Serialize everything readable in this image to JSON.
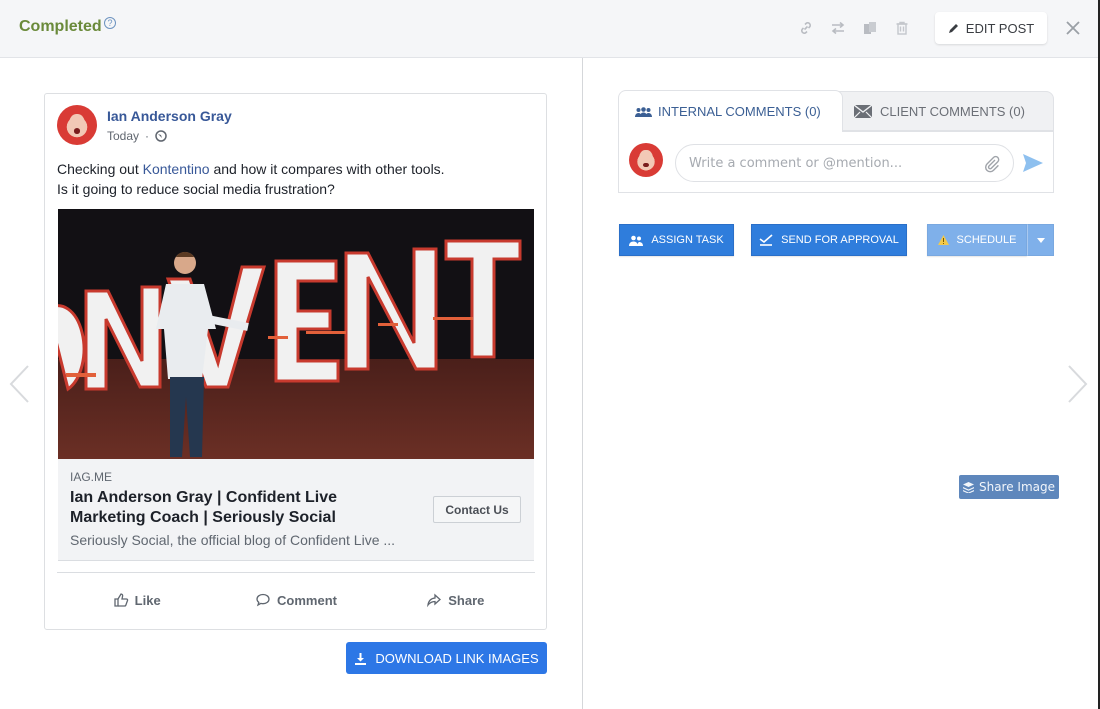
{
  "header": {
    "status": "Completed",
    "status_color": "#6a8a3a",
    "help_icon": "question-circle-icon",
    "toolbar_icons": [
      "link-icon",
      "swap-icon",
      "duplicate-icon",
      "trash-icon"
    ],
    "edit_label": "EDIT POST",
    "close_icon": "close-icon"
  },
  "navigation": {
    "prev_icon": "chevron-left-icon",
    "next_icon": "chevron-right-icon"
  },
  "post": {
    "author": "Ian Anderson Gray",
    "time": "Today",
    "separator": "·",
    "visibility_icon": "globe-icon",
    "text_before_link": "Checking out ",
    "text_link": "Kontentino",
    "text_after_link": " and how it compares with other tools.",
    "text_line2": "Is it going to reduce social media frustration?",
    "image_caption_word": "ONVENT",
    "link_preview": {
      "domain": "IAG.ME",
      "title": "Ian Anderson Gray | Confident Live Marketing Coach | Seriously Social",
      "description": "Seriously Social, the official blog of Confident Live ...",
      "cta": "Contact Us"
    },
    "actions": [
      {
        "label": "Like",
        "icon": "thumbs-up-icon"
      },
      {
        "label": "Comment",
        "icon": "comment-icon"
      },
      {
        "label": "Share",
        "icon": "share-icon"
      }
    ]
  },
  "download": {
    "label": "DOWNLOAD LINK IMAGES",
    "icon": "download-icon",
    "color": "#2d77e6"
  },
  "comments": {
    "tabs": [
      {
        "label": "INTERNAL COMMENTS (0)",
        "icon": "users-icon",
        "active": true
      },
      {
        "label": "CLIENT COMMENTS (0)",
        "icon": "envelope-icon",
        "active": false
      }
    ],
    "input_placeholder": "Write a comment or @mention...",
    "attach_icon": "paperclip-icon",
    "send_icon": "send-icon"
  },
  "actions": {
    "assign_task": "ASSIGN TASK",
    "send_for_approval": "SEND FOR APPROVAL",
    "schedule": "SCHEDULE",
    "schedule_icon": "warning-icon",
    "schedule_caret": "caret-down-icon",
    "primary_color": "#2f7ddc",
    "schedule_color": "#7fb0ea"
  },
  "share_image": {
    "label": "Share Image",
    "icon": "layers-icon"
  }
}
